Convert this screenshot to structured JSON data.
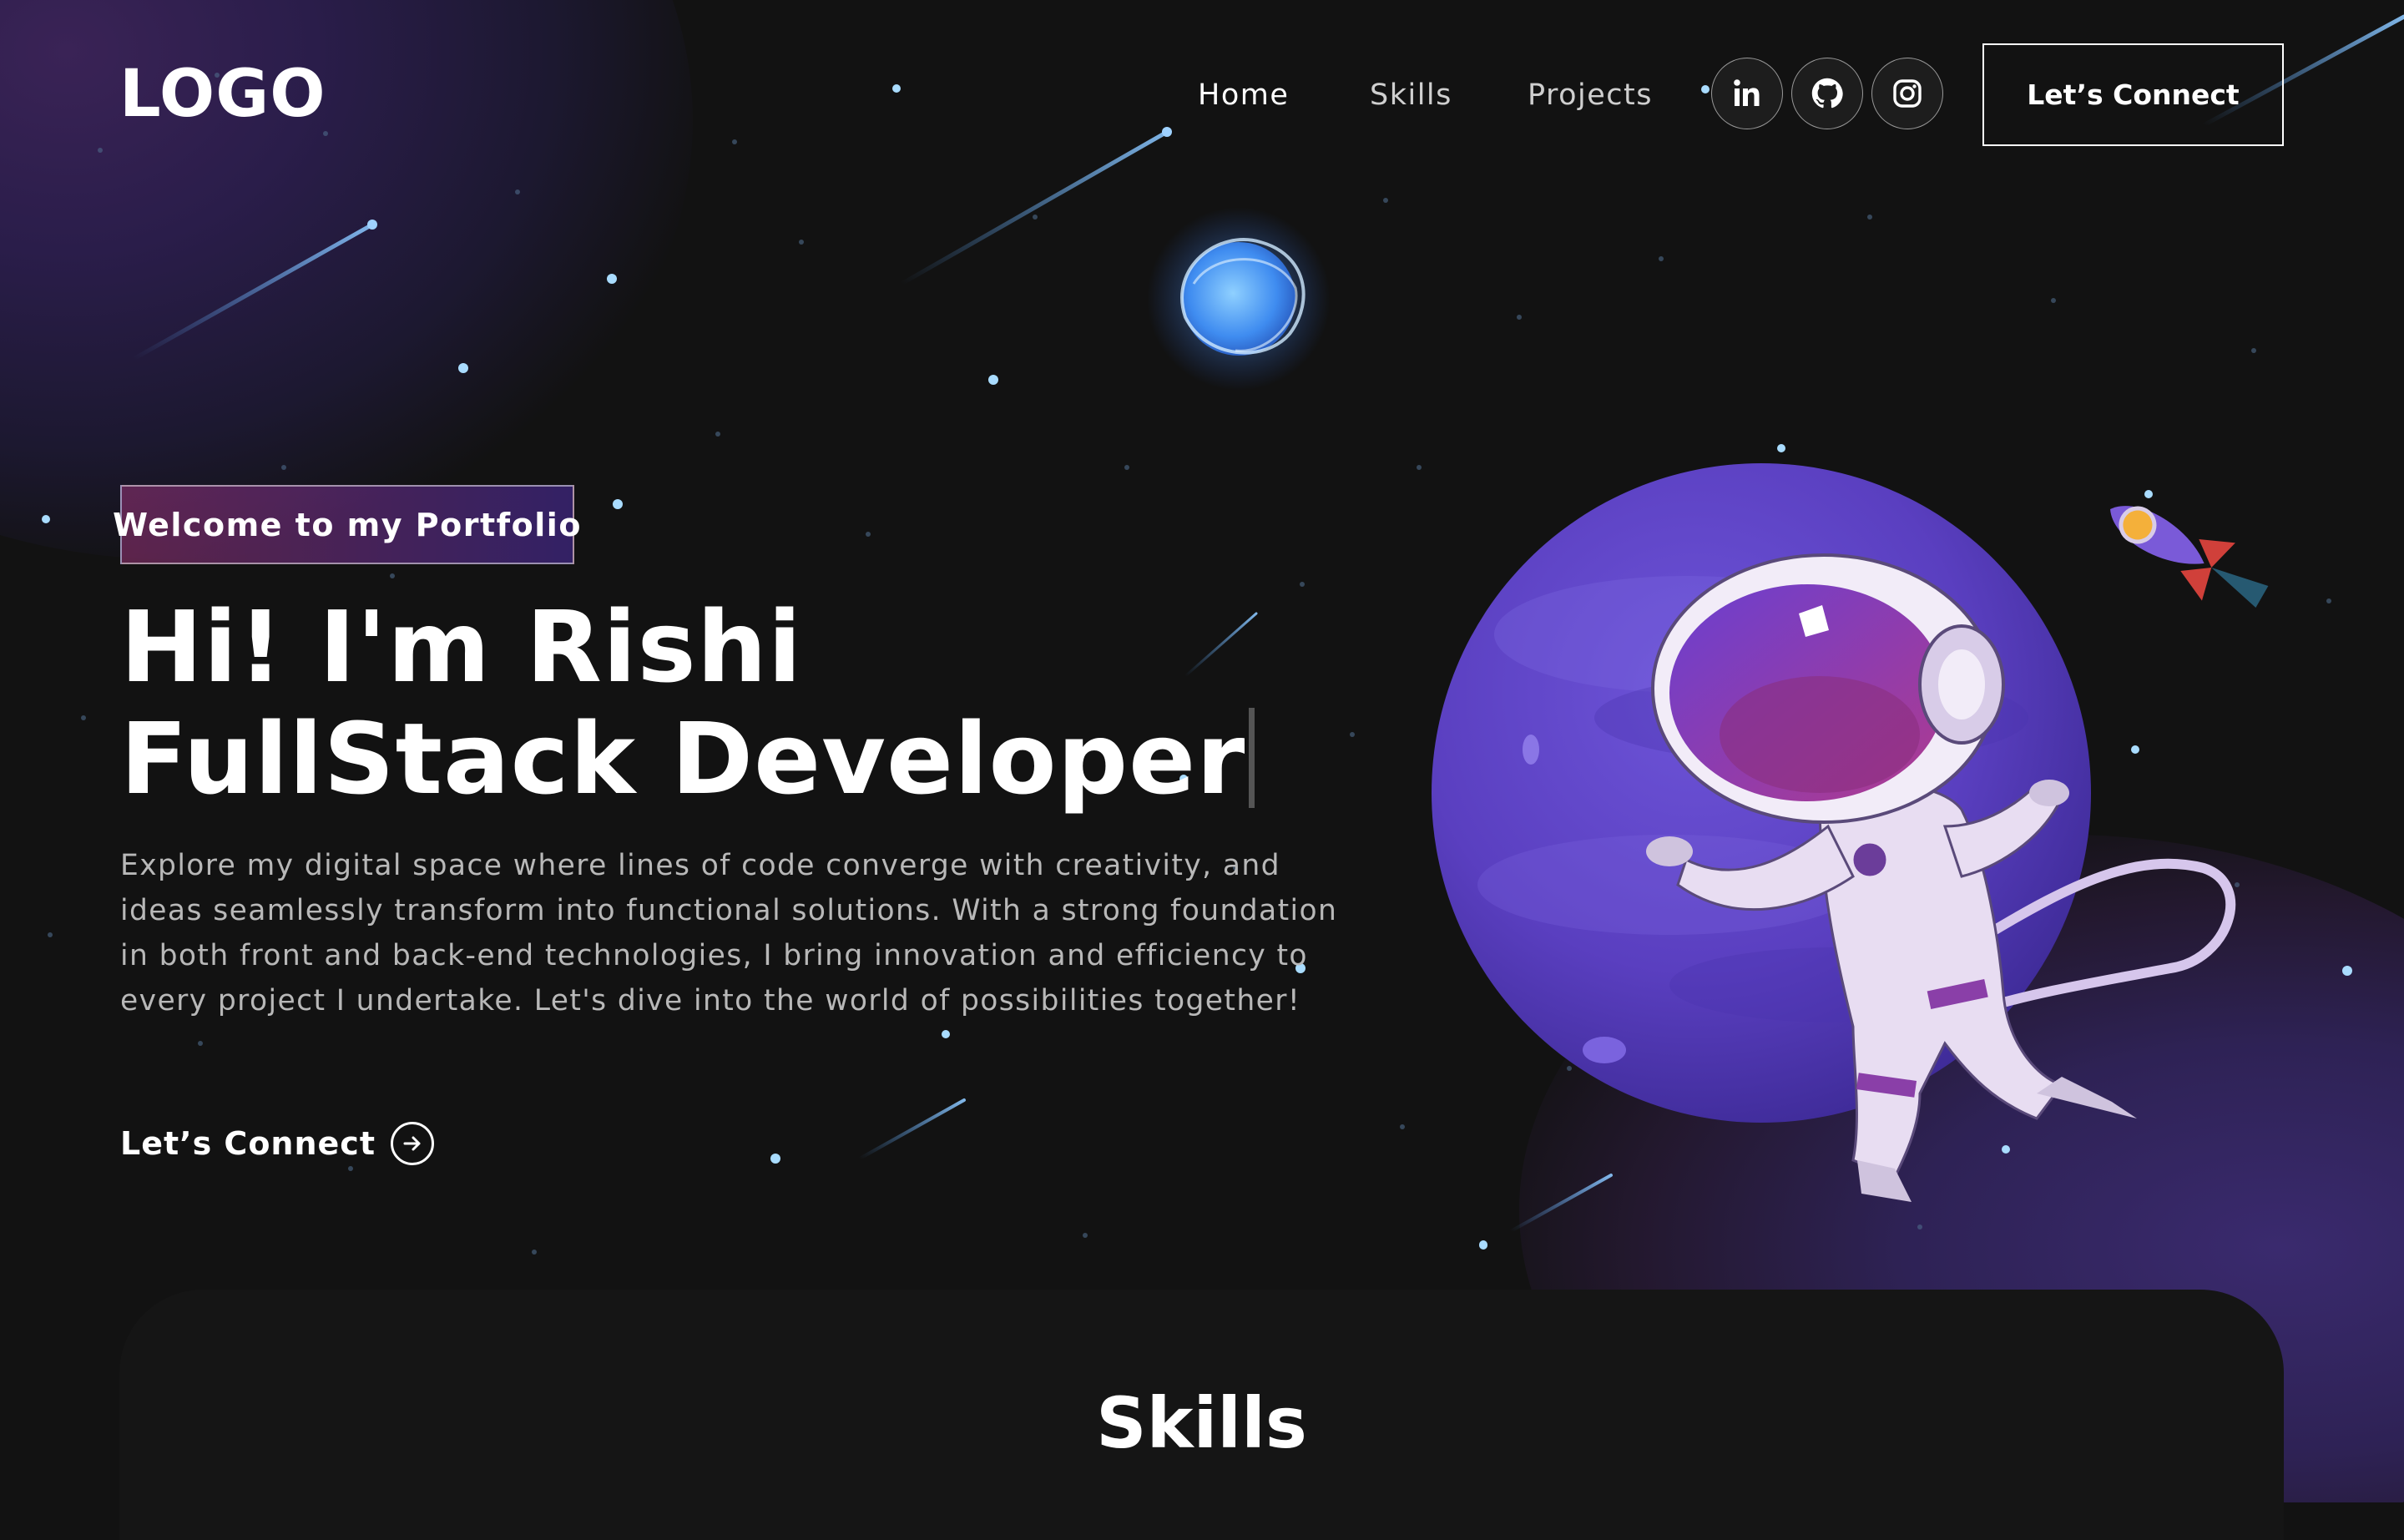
{
  "nav": {
    "logo": "LOGO",
    "links": [
      {
        "label": "Home",
        "active": true
      },
      {
        "label": "Skills",
        "active": false
      },
      {
        "label": "Projects",
        "active": false
      }
    ],
    "social": [
      {
        "icon": "linkedin-icon"
      },
      {
        "icon": "github-icon"
      },
      {
        "icon": "instagram-icon"
      }
    ],
    "connect_button": "Let’s Connect"
  },
  "hero": {
    "tagline": "Welcome to my Portfolio",
    "headline": "Hi! I'm Rishi FullStack Developer",
    "description": "Explore my digital space where lines of code converge with creativity, and ideas seamlessly transform into functional solutions. With a strong foundation in both front and back-end technologies, I bring innovation and efficiency to every project I undertake. Let's dive into the world of possibilities together!",
    "cta_label": "Let’s Connect",
    "cta_icon": "arrow-right-circle-icon",
    "illustration": "astronaut-planet-illustration"
  },
  "skills": {
    "title": "Skills"
  },
  "colors": {
    "background": "#121212",
    "accent_pink": "#AA367C",
    "accent_purple": "#4A2FBD",
    "text_muted": "#B8B8B8"
  }
}
